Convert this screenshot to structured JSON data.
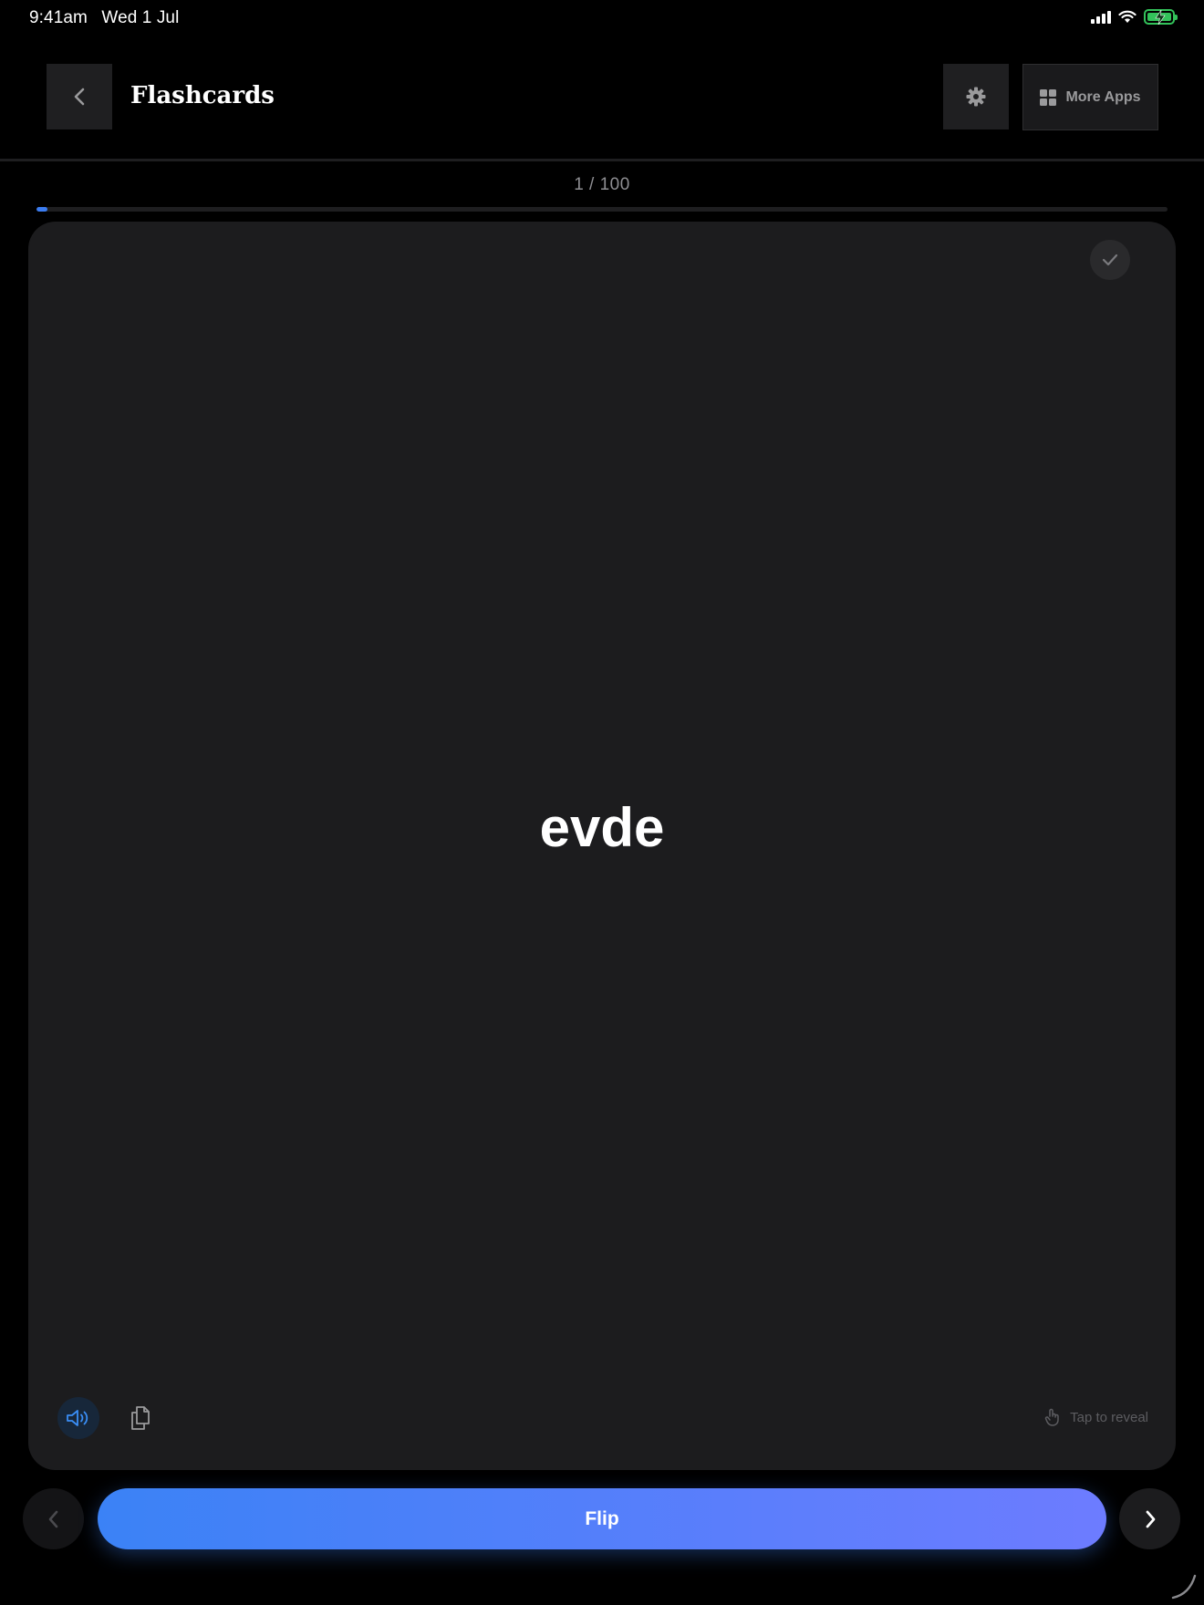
{
  "status_bar": {
    "time": "9:41am",
    "date": "Wed 1 Jul",
    "icons": [
      "signal-icon",
      "wifi-icon",
      "battery-charging-icon"
    ]
  },
  "header": {
    "title": "Flashcards",
    "back_icon": "chevron-left-icon",
    "settings_icon": "gear-icon",
    "more_apps_label": "More Apps",
    "more_apps_icon": "grid-icon"
  },
  "progress": {
    "counter_text": "1 / 100",
    "current": 1,
    "total": 100,
    "fraction": 0.01,
    "color": "#3b7cf0"
  },
  "card": {
    "word": "evde",
    "check_icon": "checkmark-icon",
    "audio_icon": "speaker-icon",
    "copy_icon": "copy-icon",
    "hint_icon": "tap-hand-icon",
    "hint_text": "Tap to reveal"
  },
  "controls": {
    "prev_icon": "chevron-left-icon",
    "flip_label": "Flip",
    "next_icon": "chevron-right-icon",
    "flip_gradient": [
      "#3b82f6",
      "#6d7cff"
    ]
  }
}
